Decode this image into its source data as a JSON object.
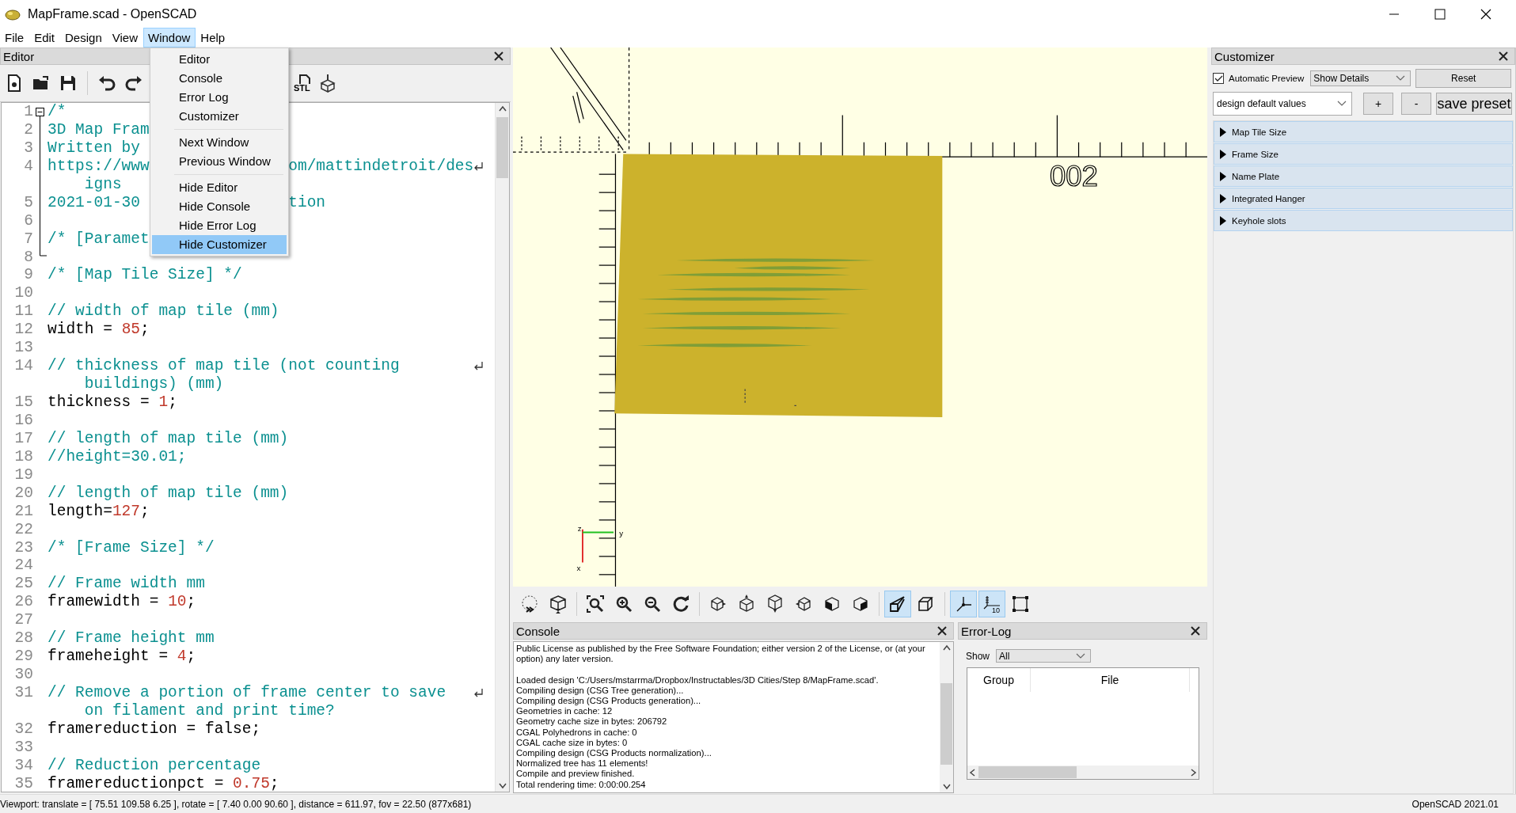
{
  "window": {
    "title": "MapFrame.scad - OpenSCAD"
  },
  "menu_bar": [
    {
      "label": "File",
      "selected": false
    },
    {
      "label": "Edit",
      "selected": false
    },
    {
      "label": "Design",
      "selected": false
    },
    {
      "label": "View",
      "selected": false
    },
    {
      "label": "Window",
      "selected": true
    },
    {
      "label": "Help",
      "selected": false
    }
  ],
  "window_menu": [
    [
      {
        "label": "Editor",
        "selected": false
      },
      {
        "label": "Console",
        "selected": false
      },
      {
        "label": "Error Log",
        "selected": false
      },
      {
        "label": "Customizer",
        "selected": false
      }
    ],
    [
      {
        "label": "Next Window",
        "selected": false
      },
      {
        "label": "Previous Window",
        "selected": false
      }
    ],
    [
      {
        "label": "Hide Editor",
        "selected": false
      },
      {
        "label": "Hide Console",
        "selected": false
      },
      {
        "label": "Hide Error Log",
        "selected": false
      },
      {
        "label": "Hide Customizer",
        "selected": true
      }
    ]
  ],
  "editor": {
    "title": "Editor",
    "export_label": "STL",
    "lines": [
      {
        "n": "1",
        "seg": [
          {
            "kind": "comment",
            "text": "/*"
          }
        ]
      },
      {
        "n": "2",
        "seg": [
          {
            "kind": "comment",
            "text": "3D Map Fram"
          }
        ]
      },
      {
        "n": "3",
        "seg": [
          {
            "kind": "comment",
            "text": "Written by"
          }
        ]
      },
      {
        "n": "4",
        "seg": [
          {
            "kind": "comment",
            "text": "https://www"
          }
        ],
        "tail": "om/mattindetroit/des",
        "wrap": "igns"
      },
      {
        "n": "5",
        "seg": [
          {
            "kind": "comment",
            "text": "2021-01-30"
          }
        ],
        "tail": "tion"
      },
      {
        "n": "6"
      },
      {
        "n": "7",
        "seg": [
          {
            "kind": "comment",
            "text": "/* [Paramet"
          }
        ]
      },
      {
        "n": "8"
      },
      {
        "n": "9",
        "seg": [
          {
            "kind": "comment",
            "text": "/* [Map Tile Size] */"
          }
        ]
      },
      {
        "n": "10"
      },
      {
        "n": "11",
        "seg": [
          {
            "kind": "comment",
            "text": "// width of map tile (mm)"
          }
        ]
      },
      {
        "n": "12",
        "seg": [
          {
            "kind": "code",
            "text": "width = "
          },
          {
            "kind": "number",
            "text": "85"
          },
          {
            "kind": "code",
            "text": ";"
          }
        ]
      },
      {
        "n": "13"
      },
      {
        "n": "14",
        "seg": [
          {
            "kind": "comment",
            "text": "// thickness of map tile (not counting"
          }
        ],
        "wrap": "buildings) (mm)"
      },
      {
        "n": "15",
        "seg": [
          {
            "kind": "code",
            "text": "thickness = "
          },
          {
            "kind": "number",
            "text": "1"
          },
          {
            "kind": "code",
            "text": ";"
          }
        ]
      },
      {
        "n": "16"
      },
      {
        "n": "17",
        "seg": [
          {
            "kind": "comment",
            "text": "// length of map tile (mm)"
          }
        ]
      },
      {
        "n": "18",
        "seg": [
          {
            "kind": "comment",
            "text": "//height=30.01;"
          }
        ]
      },
      {
        "n": "19"
      },
      {
        "n": "20",
        "seg": [
          {
            "kind": "comment",
            "text": "// length of map tile (mm)"
          }
        ]
      },
      {
        "n": "21",
        "seg": [
          {
            "kind": "code",
            "text": "length="
          },
          {
            "kind": "number",
            "text": "127"
          },
          {
            "kind": "code",
            "text": ";"
          }
        ]
      },
      {
        "n": "22"
      },
      {
        "n": "23",
        "seg": [
          {
            "kind": "comment",
            "text": "/* [Frame Size] */"
          }
        ]
      },
      {
        "n": "24"
      },
      {
        "n": "25",
        "seg": [
          {
            "kind": "comment",
            "text": "// Frame width mm"
          }
        ]
      },
      {
        "n": "26",
        "seg": [
          {
            "kind": "code",
            "text": "framewidth = "
          },
          {
            "kind": "number",
            "text": "10"
          },
          {
            "kind": "code",
            "text": ";"
          }
        ]
      },
      {
        "n": "27"
      },
      {
        "n": "28",
        "seg": [
          {
            "kind": "comment",
            "text": "// Frame height mm"
          }
        ]
      },
      {
        "n": "29",
        "seg": [
          {
            "kind": "code",
            "text": "frameheight = "
          },
          {
            "kind": "number",
            "text": "4"
          },
          {
            "kind": "code",
            "text": ";"
          }
        ]
      },
      {
        "n": "30"
      },
      {
        "n": "31",
        "seg": [
          {
            "kind": "comment",
            "text": "// Remove a portion of frame center to save"
          }
        ],
        "wrap": "on filament and print time?"
      },
      {
        "n": "32",
        "seg": [
          {
            "kind": "code",
            "text": "framereduction = false;"
          }
        ]
      },
      {
        "n": "33"
      },
      {
        "n": "34",
        "seg": [
          {
            "kind": "comment",
            "text": "// Reduction percentage"
          }
        ]
      },
      {
        "n": "35",
        "seg": [
          {
            "kind": "code",
            "text": "framereductionpct = "
          },
          {
            "kind": "number",
            "text": "0.75"
          },
          {
            "kind": "code",
            "text": ";"
          }
        ]
      }
    ]
  },
  "viewport": {
    "model_text": "002",
    "axis_labels": [
      "z",
      "y",
      "x"
    ]
  },
  "viewport_toolbar": [
    [
      {
        "kind": "preview",
        "on": false
      },
      {
        "kind": "render",
        "on": false
      }
    ],
    [
      {
        "kind": "view-all",
        "on": false
      },
      {
        "kind": "zoom-in",
        "on": false
      },
      {
        "kind": "zoom-out",
        "on": false
      },
      {
        "kind": "reset-view",
        "on": false
      }
    ],
    [
      {
        "kind": "view-right",
        "on": false
      },
      {
        "kind": "view-top",
        "on": false
      },
      {
        "kind": "view-bottom",
        "on": false
      },
      {
        "kind": "view-left",
        "on": false
      },
      {
        "kind": "view-front",
        "on": false
      },
      {
        "kind": "view-back",
        "on": false
      }
    ],
    [
      {
        "kind": "perspective",
        "on": true
      },
      {
        "kind": "orthogonal",
        "on": false
      }
    ],
    [
      {
        "kind": "axes",
        "on": true
      },
      {
        "kind": "scale-markers",
        "on": true,
        "label": "10"
      },
      {
        "kind": "edges",
        "on": false
      }
    ]
  ],
  "console": {
    "title": "Console",
    "paragraphs": [
      [
        "Public License as published by the Free Software Foundation; either version 2 of the License, or (at your",
        "option) any later version."
      ],
      [
        "Loaded design 'C:/Users/mstarrma/Dropbox/Instructables/3D Cities/Step 8/MapFrame.scad'.",
        "Compiling design (CSG Tree generation)...",
        "Compiling design (CSG Products generation)...",
        "Geometries in cache: 12",
        "Geometry cache size in bytes: 206792",
        "CGAL Polyhedrons in cache: 0",
        "CGAL cache size in bytes: 0",
        "Compiling design (CSG Products normalization)...",
        "Normalized tree has 11 elements!",
        "Compile and preview finished.",
        "Total rendering time: 0:00:00.254"
      ]
    ]
  },
  "error_log": {
    "title": "Error-Log",
    "show_label": "Show",
    "show_value": "All",
    "columns": [
      "Group",
      "File"
    ]
  },
  "customizer": {
    "title": "Customizer",
    "automatic_preview": {
      "label": "Automatic Preview",
      "checked": true
    },
    "details_select": "Show Details",
    "reset_button": "Reset",
    "preset_select": "design default values",
    "add_button": "+",
    "remove_button": "-",
    "save_button": "save preset",
    "groups": [
      {
        "label": "Map Tile Size",
        "expanded": false
      },
      {
        "label": "Frame Size",
        "expanded": false
      },
      {
        "label": "Name Plate",
        "expanded": false
      },
      {
        "label": "Integrated Hanger",
        "expanded": false
      },
      {
        "label": "Keyhole slots",
        "expanded": false
      }
    ]
  },
  "status_bar": {
    "viewport": "Viewport: translate = [ 75.51 109.58 6.25 ], rotate = [ 7.40 0.00 90.60 ], distance = 611.97, fov = 22.50 (877x681)",
    "version": "OpenSCAD 2021.01"
  }
}
